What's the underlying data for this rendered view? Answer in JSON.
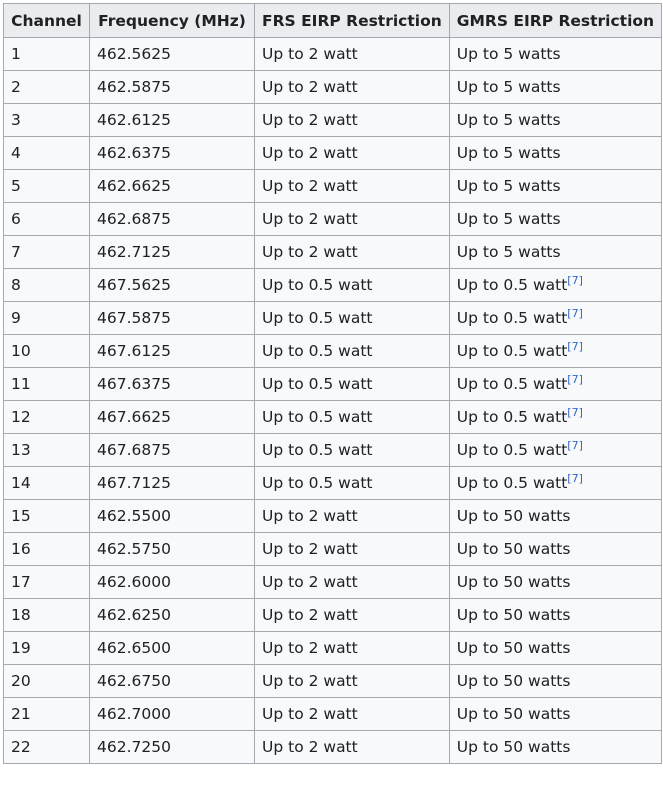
{
  "table": {
    "headers": [
      "Channel",
      "Frequency (MHz)",
      "FRS EIRP Restriction",
      "GMRS EIRP Restriction"
    ],
    "rows": [
      {
        "channel": "1",
        "frequency": "462.5625",
        "frs": "Up to 2 watt",
        "gmrs": "Up to 5 watts",
        "ref": ""
      },
      {
        "channel": "2",
        "frequency": "462.5875",
        "frs": "Up to 2 watt",
        "gmrs": "Up to 5 watts",
        "ref": ""
      },
      {
        "channel": "3",
        "frequency": "462.6125",
        "frs": "Up to 2 watt",
        "gmrs": "Up to 5 watts",
        "ref": ""
      },
      {
        "channel": "4",
        "frequency": "462.6375",
        "frs": "Up to 2 watt",
        "gmrs": "Up to 5 watts",
        "ref": ""
      },
      {
        "channel": "5",
        "frequency": "462.6625",
        "frs": "Up to 2 watt",
        "gmrs": "Up to 5 watts",
        "ref": ""
      },
      {
        "channel": "6",
        "frequency": "462.6875",
        "frs": "Up to 2 watt",
        "gmrs": "Up to 5 watts",
        "ref": ""
      },
      {
        "channel": "7",
        "frequency": "462.7125",
        "frs": "Up to 2 watt",
        "gmrs": "Up to 5 watts",
        "ref": ""
      },
      {
        "channel": "8",
        "frequency": "467.5625",
        "frs": "Up to 0.5 watt",
        "gmrs": "Up to 0.5 watt",
        "ref": "[7]"
      },
      {
        "channel": "9",
        "frequency": "467.5875",
        "frs": "Up to 0.5 watt",
        "gmrs": "Up to 0.5 watt",
        "ref": "[7]"
      },
      {
        "channel": "10",
        "frequency": "467.6125",
        "frs": "Up to 0.5 watt",
        "gmrs": "Up to 0.5 watt",
        "ref": "[7]"
      },
      {
        "channel": "11",
        "frequency": "467.6375",
        "frs": "Up to 0.5 watt",
        "gmrs": "Up to 0.5 watt",
        "ref": "[7]"
      },
      {
        "channel": "12",
        "frequency": "467.6625",
        "frs": "Up to 0.5 watt",
        "gmrs": "Up to 0.5 watt",
        "ref": "[7]"
      },
      {
        "channel": "13",
        "frequency": "467.6875",
        "frs": "Up to 0.5 watt",
        "gmrs": "Up to 0.5 watt",
        "ref": "[7]"
      },
      {
        "channel": "14",
        "frequency": "467.7125",
        "frs": "Up to 0.5 watt",
        "gmrs": "Up to 0.5 watt",
        "ref": "[7]"
      },
      {
        "channel": "15",
        "frequency": "462.5500",
        "frs": "Up to 2 watt",
        "gmrs": "Up to 50 watts",
        "ref": ""
      },
      {
        "channel": "16",
        "frequency": "462.5750",
        "frs": "Up to 2 watt",
        "gmrs": "Up to 50 watts",
        "ref": ""
      },
      {
        "channel": "17",
        "frequency": "462.6000",
        "frs": "Up to 2 watt",
        "gmrs": "Up to 50 watts",
        "ref": ""
      },
      {
        "channel": "18",
        "frequency": "462.6250",
        "frs": "Up to 2 watt",
        "gmrs": "Up to 50 watts",
        "ref": ""
      },
      {
        "channel": "19",
        "frequency": "462.6500",
        "frs": "Up to 2 watt",
        "gmrs": "Up to 50 watts",
        "ref": ""
      },
      {
        "channel": "20",
        "frequency": "462.6750",
        "frs": "Up to 2 watt",
        "gmrs": "Up to 50 watts",
        "ref": ""
      },
      {
        "channel": "21",
        "frequency": "462.7000",
        "frs": "Up to 2 watt",
        "gmrs": "Up to 50 watts",
        "ref": ""
      },
      {
        "channel": "22",
        "frequency": "462.7250",
        "frs": "Up to 2 watt",
        "gmrs": "Up to 50 watts",
        "ref": ""
      }
    ]
  },
  "colors": {
    "header_bg": "#eaecf0",
    "cell_bg": "#f8f9fa",
    "border": "#a2a9b1",
    "text": "#202122",
    "link": "#3366cc"
  }
}
